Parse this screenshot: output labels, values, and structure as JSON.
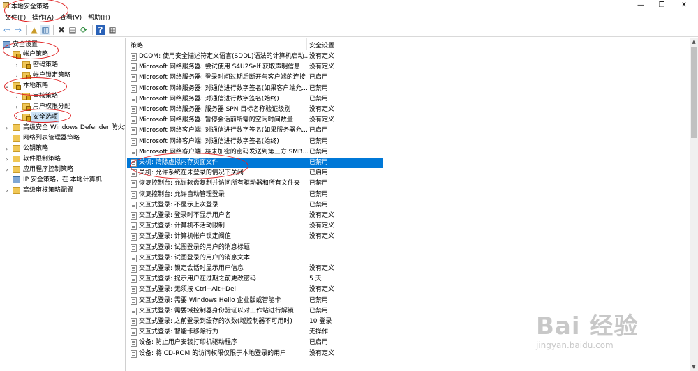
{
  "window": {
    "title": "本地安全策略",
    "minimize_glyph": "—",
    "restore_glyph": "❐",
    "close_glyph": "✕"
  },
  "menu": [
    "文件(F)",
    "操作(A)",
    "查看(V)",
    "帮助(H)"
  ],
  "toolbar": {
    "back": "⇦",
    "forward": "⇨",
    "up": "▲",
    "show_tree": "▥",
    "delete": "✖",
    "properties": "▤",
    "refresh": "⟳",
    "export": "⇥",
    "help": "?",
    "console": "▦"
  },
  "tree": {
    "items": [
      {
        "label": "安全设置",
        "twisty": "⌄"
      },
      {
        "label": "帐户策略",
        "twisty": "⌄"
      },
      {
        "label": "密码策略",
        "twisty": "›"
      },
      {
        "label": "帐户锁定策略",
        "twisty": "›"
      },
      {
        "label": "本地策略",
        "twisty": "⌄"
      },
      {
        "label": "审核策略",
        "twisty": "›"
      },
      {
        "label": "用户权限分配",
        "twisty": "›"
      },
      {
        "label": "安全选项",
        "twisty": "›"
      },
      {
        "label": "高级安全 Windows Defender 防火墙",
        "twisty": "›"
      },
      {
        "label": "网络列表管理器策略",
        "twisty": ""
      },
      {
        "label": "公钥策略",
        "twisty": "›"
      },
      {
        "label": "软件限制策略",
        "twisty": "›"
      },
      {
        "label": "应用程序控制策略",
        "twisty": "›"
      },
      {
        "label": "IP 安全策略，在 本地计算机",
        "twisty": ""
      },
      {
        "label": "高级审核策略配置",
        "twisty": "›"
      }
    ]
  },
  "list": {
    "col_policy": "策略",
    "col_setting": "安全设置",
    "sort_glyph": "˄",
    "rows": [
      {
        "name": "DCOM: 使用安全描述符定义语言(SDDL)语法的计算机启动...",
        "value": "没有定义"
      },
      {
        "name": "Microsoft 网络服务器: 尝试使用 S4U2Self 获取声明信息",
        "value": "没有定义"
      },
      {
        "name": "Microsoft 网络服务器: 登录时间过期后断开与客户端的连接",
        "value": "已启用"
      },
      {
        "name": "Microsoft 网络服务器: 对通信进行数字签名(如果客户端允...",
        "value": "已禁用"
      },
      {
        "name": "Microsoft 网络服务器: 对通信进行数字签名(始终)",
        "value": "已禁用"
      },
      {
        "name": "Microsoft 网络服务器: 服务器 SPN 目标名称验证级别",
        "value": "没有定义"
      },
      {
        "name": "Microsoft 网络服务器: 暂停会话前所需的空闲时间数量",
        "value": "没有定义"
      },
      {
        "name": "Microsoft 网络客户端: 对通信进行数字签名(如果服务器允...",
        "value": "已启用"
      },
      {
        "name": "Microsoft 网络客户端: 对通信进行数字签名(始终)",
        "value": "已禁用"
      },
      {
        "name": "Microsoft 网络客户端: 将未加密的密码发送到第三方 SMB...",
        "value": "已禁用"
      },
      {
        "name": "关机: 清除虚拟内存页面文件",
        "value": "已禁用"
      },
      {
        "name": "关机: 允许系统在未登录的情况下关闭",
        "value": "已启用"
      },
      {
        "name": "恢复控制台: 允许软盘复制并访问所有驱动器和所有文件夹",
        "value": "已禁用"
      },
      {
        "name": "恢复控制台: 允许自动管理登录",
        "value": "已禁用"
      },
      {
        "name": "交互式登录: 不显示上次登录",
        "value": "已禁用"
      },
      {
        "name": "交互式登录: 登录时不显示用户名",
        "value": "没有定义"
      },
      {
        "name": "交互式登录: 计算机不活动限制",
        "value": "没有定义"
      },
      {
        "name": "交互式登录: 计算机帐户锁定阈值",
        "value": "没有定义"
      },
      {
        "name": "交互式登录: 试图登录的用户的消息标题",
        "value": ""
      },
      {
        "name": "交互式登录: 试图登录的用户的消息文本",
        "value": ""
      },
      {
        "name": "交互式登录: 锁定会话时显示用户信息",
        "value": "没有定义"
      },
      {
        "name": "交互式登录: 提示用户在过期之前更改密码",
        "value": "5 天"
      },
      {
        "name": "交互式登录: 无须按 Ctrl+Alt+Del",
        "value": "没有定义"
      },
      {
        "name": "交互式登录: 需要 Windows Hello 企业版或智能卡",
        "value": "已禁用"
      },
      {
        "name": "交互式登录: 需要域控制器身份验证以对工作站进行解锁",
        "value": "已禁用"
      },
      {
        "name": "交互式登录: 之前登录到缓存的次数(域控制器不可用时)",
        "value": "10 登录"
      },
      {
        "name": "交互式登录: 智能卡移除行为",
        "value": "无操作"
      },
      {
        "name": "设备: 防止用户安装打印机驱动程序",
        "value": "已启用"
      },
      {
        "name": "设备: 将 CD-ROM 的访问权限仅限于本地登录的用户",
        "value": "没有定义"
      }
    ]
  },
  "watermark": {
    "logo": "Bai 经验",
    "url": "jingyan.baidu.com"
  },
  "colors": {
    "selection": "#0078d7",
    "annotation": "#e02020"
  }
}
